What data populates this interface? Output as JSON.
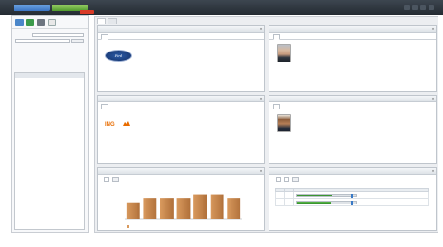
{
  "topbar": {
    "tabs": [
      {
        "label": ""
      },
      {
        "label": ""
      }
    ],
    "alert_text": "",
    "right_links": [
      "",
      "",
      "",
      ""
    ]
  },
  "sidebar": {
    "title": "",
    "fields": [
      {
        "label": "",
        "value": ""
      },
      {
        "label": "",
        "value": ""
      }
    ],
    "tree_header": "",
    "tree_root": "",
    "tree_items": [
      "",
      "",
      "",
      "",
      "",
      "",
      "",
      "",
      "",
      "",
      "",
      "",
      "",
      "",
      "",
      "",
      "",
      "",
      "",
      "",
      "",
      "",
      "",
      "",
      "",
      "",
      "",
      "",
      "",
      "",
      "",
      "",
      "",
      "",
      "",
      "",
      ""
    ]
  },
  "main_tabs": [
    "",
    ""
  ],
  "panels": {
    "p1": {
      "title": "",
      "tabs": [
        "",
        "",
        "",
        "",
        "",
        ""
      ],
      "logo_text": "Ford",
      "info": {
        "name": "",
        "lines": [
          "",
          "",
          "",
          "",
          ""
        ]
      }
    },
    "p2": {
      "title": "",
      "tabs": [
        "",
        "",
        "",
        "",
        "",
        ""
      ],
      "info": {
        "name": "",
        "lines": [
          "",
          ""
        ]
      }
    },
    "p3": {
      "title": "",
      "tabs": [
        "",
        "",
        "",
        "",
        "",
        ""
      ],
      "logo_text": "ING",
      "info": {
        "name": "",
        "lines": [
          "",
          "",
          "",
          "",
          "",
          ""
        ]
      }
    },
    "p4": {
      "title": "",
      "tabs": [
        "",
        "",
        "",
        "",
        "",
        ""
      ],
      "info": {
        "name": "",
        "lines": [
          "",
          ""
        ]
      }
    },
    "p5": {
      "title": "",
      "controls": {
        "label": "",
        "dropdown": "",
        "button": ""
      },
      "legend": ""
    },
    "p6": {
      "title": "",
      "controls": {
        "label": "",
        "dropdown1": "",
        "dropdown2": "",
        "button": ""
      },
      "subtitle": "",
      "table": {
        "headers": [
          "",
          "",
          ""
        ],
        "rows": [
          {
            "name": "",
            "value": "",
            "progress": 0.58,
            "marker": 0.9
          },
          {
            "name": "",
            "value": "",
            "progress": 0.57,
            "marker": 0.9
          }
        ]
      }
    }
  },
  "chart_data": {
    "type": "bar",
    "categories": [
      "",
      "",
      "",
      "",
      "",
      "",
      ""
    ],
    "values": [
      4,
      5,
      5,
      5,
      6,
      6,
      5
    ],
    "ylim": [
      0,
      7
    ],
    "colors": [
      "#d99a5e",
      "#b0703a"
    ]
  }
}
